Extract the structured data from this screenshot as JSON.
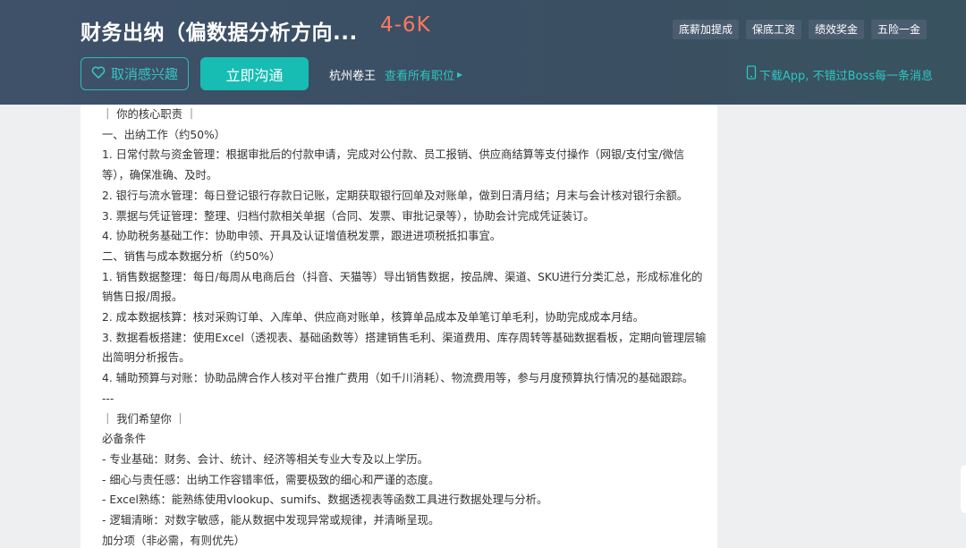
{
  "header": {
    "title": "财务出纳（偏数据分析方向...",
    "salary": "4-6K",
    "tags": [
      "底薪加提成",
      "保底工资",
      "绩效奖金",
      "五险一金"
    ],
    "interest_button": "取消感兴趣",
    "chat_button": "立即沟通",
    "company": "杭州卷王",
    "view_all": "查看所有职位",
    "download_text": "下载App, 不错过Boss每一条消息"
  },
  "content": {
    "lines": [
      "｜ 你的核心职责 ｜",
      "一、出纳工作（约50%）",
      "1. 日常付款与资金管理：根据审批后的付款申请，完成对公付款、员工报销、供应商结算等支付操作（网银/支付宝/微信",
      "等），确保准确、及时。",
      "2. 银行与流水管理：每日登记银行存款日记账，定期获取银行回单及对账单，做到日清月结；月末与会计核对银行余额。",
      "3. 票据与凭证管理：整理、归档付款相关单据（合同、发票、审批记录等），协助会计完成凭证装订。",
      "4. 协助税务基础工作：协助申领、开具及认证增值税发票，跟进进项税抵扣事宜。",
      "二、销售与成本数据分析（约50%）",
      "1. 销售数据整理：每日/每周从电商后台（抖音、天猫等）导出销售数据，按品牌、渠道、SKU进行分类汇总，形成标准化的",
      "销售日报/周报。",
      "2. 成本数据核算：核对采购订单、入库单、供应商对账单，核算单品成本及单笔订单毛利，协助完成成本月结。",
      "3. 数据看板搭建：使用Excel（透视表、基础函数等）搭建销售毛利、渠道费用、库存周转等基础数据看板，定期向管理层输",
      "出简明分析报告。",
      "4. 辅助预算与对账：协助品牌合作人核对平台推广费用（如千川消耗）、物流费用等，参与月度预算执行情况的基础跟踪。",
      "---",
      "｜ 我们希望你 ｜",
      "必备条件",
      "- 专业基础：财务、会计、统计、经济等相关专业大专及以上学历。",
      "- 细心与责任感：出纳工作容错率低，需要极致的细心和严谨的态度。",
      "- Excel熟练：能熟练使用vlookup、sumifs、数据透视表等函数工具进行数据处理与分析。",
      "- 逻辑清晰：对数字敏感，能从数据中发现异常或规律，并清晰呈现。",
      "加分项（非必需，有则优先）"
    ]
  },
  "colors": {
    "header_bg": "#3c5065",
    "accent": "#17bdb3",
    "salary": "#ff7760",
    "page_bg": "#eeeff1"
  },
  "icons": [
    "heart-icon",
    "phone-icon",
    "caret-right-icon"
  ]
}
